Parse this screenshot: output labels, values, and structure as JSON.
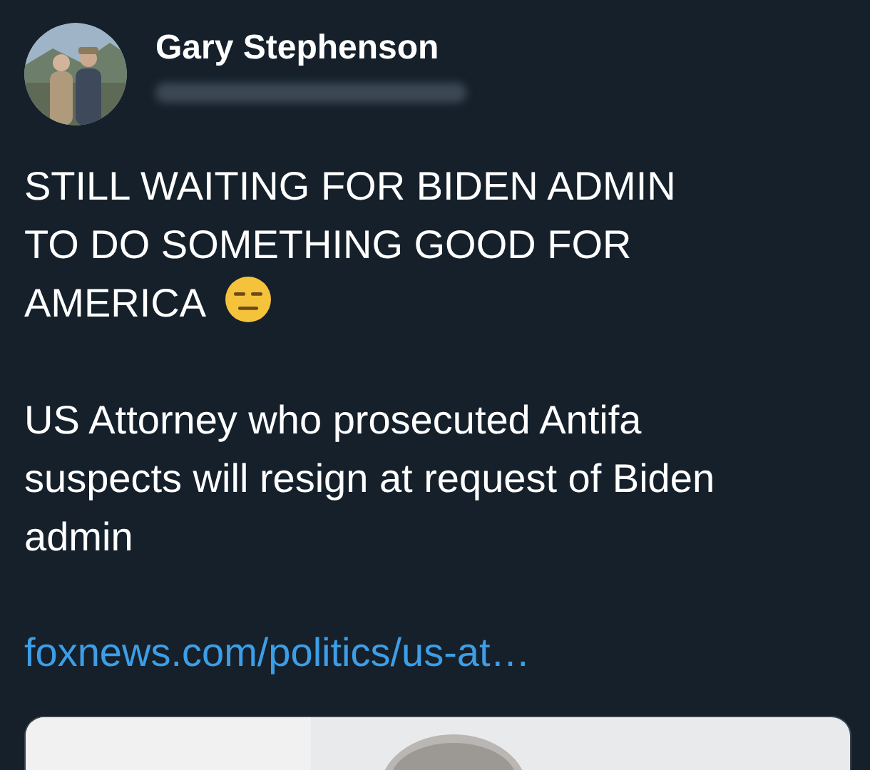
{
  "author": {
    "name": "Gary Stephenson"
  },
  "post": {
    "headline": "STILL WAITING FOR BIDEN ADMIN TO DO SOMETHING GOOD FOR AMERICA",
    "body": "US Attorney who prosecuted Antifa suspects will resign at request of Biden admin",
    "link": "foxnews.com/politics/us-at…"
  }
}
